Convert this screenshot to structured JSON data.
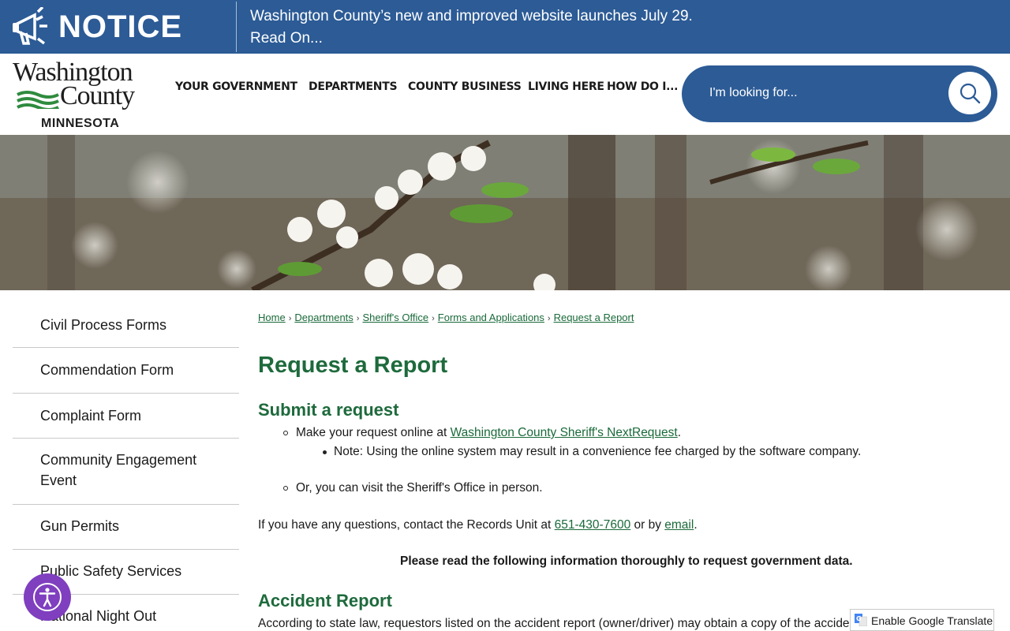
{
  "notice": {
    "label": "NOTICE",
    "line1": "Washington County’s new and improved website launches July 29.",
    "line2": "Read On..."
  },
  "logo": {
    "word1": "Washington",
    "word2": "County",
    "state": "MINNESOTA"
  },
  "nav": [
    {
      "label": "YOUR GOVERNMENT"
    },
    {
      "label": "DEPARTMENTS"
    },
    {
      "label": "COUNTY BUSINESS"
    },
    {
      "label": "LIVING HERE"
    },
    {
      "label": "HOW DO I..."
    }
  ],
  "search": {
    "placeholder": "I'm looking for..."
  },
  "sidebar": [
    {
      "label": "Civil Process Forms"
    },
    {
      "label": "Commendation Form"
    },
    {
      "label": "Complaint Form"
    },
    {
      "label": "Community Engagement Event"
    },
    {
      "label": "Gun Permits"
    },
    {
      "label": "Public Safety Services"
    },
    {
      "label": "National Night Out"
    }
  ],
  "breadcrumb": [
    {
      "label": "Home"
    },
    {
      "label": "Departments"
    },
    {
      "label": "Sheriff's Office"
    },
    {
      "label": "Forms and Applications"
    },
    {
      "label": "Request a Report"
    }
  ],
  "page": {
    "title": "Request a Report",
    "section1": "Submit a request",
    "item1_prefix": "Make your request online at ",
    "item1_link": "Washington County Sheriff's NextRequest",
    "item1_suffix": ".",
    "subitem1": "Note: Using the online system may result in a convenience fee charged by the software company.",
    "item2": "Or, you can visit the Sheriff's Office in person.",
    "contact_prefix": "If you have any questions, contact the Records Unit at ",
    "contact_phone": "651-430-7600",
    "contact_mid": " or by ",
    "contact_email": "email",
    "contact_suffix": ".",
    "notice_bold": "Please read the following information thoroughly to request government data.",
    "section2": "Accident Report",
    "accident_text": "According to state law, requestors listed on the accident report (owner/driver) may obtain a copy of the accide"
  },
  "translate": {
    "label": "Enable Google Translate"
  },
  "colors": {
    "brand_blue": "#2c5b96",
    "heading_green": "#1e6a3c",
    "accessibility_purple": "#7f3fbf"
  }
}
